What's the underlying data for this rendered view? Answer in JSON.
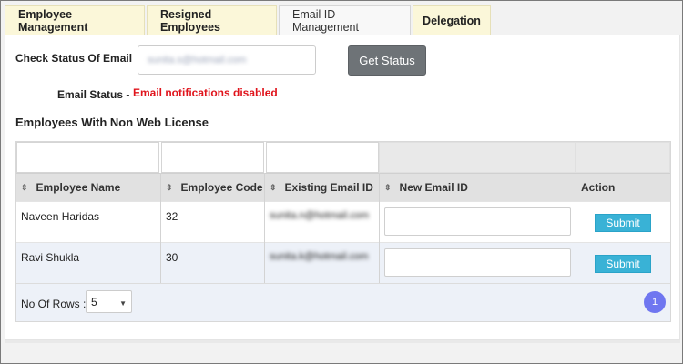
{
  "tabs": [
    {
      "label": "Employee Management"
    },
    {
      "label": "Resigned Employees"
    },
    {
      "label": "Email ID Management"
    },
    {
      "label": "Delegation"
    }
  ],
  "check": {
    "label": "Check Status Of Email",
    "email_value": "sunita.s@hotmail.com",
    "button_label": "Get Status"
  },
  "status": {
    "label": "Email Status -",
    "value": "Email notifications disabled"
  },
  "section_title": "Employees With Non Web License",
  "table": {
    "columns": [
      "Employee Name",
      "Employee Code",
      "Existing Email ID",
      "New Email ID",
      "Action"
    ],
    "rows": [
      {
        "name": "Naveen Haridas",
        "code": "32",
        "existing_email": "sunita.n@hotmail.com",
        "action": "Submit"
      },
      {
        "name": "Ravi Shukla",
        "code": "30",
        "existing_email": "sunita.k@hotmail.com",
        "action": "Submit"
      }
    ],
    "rows_label": "No Of Rows :",
    "rows_value": "5",
    "page": "1"
  }
}
